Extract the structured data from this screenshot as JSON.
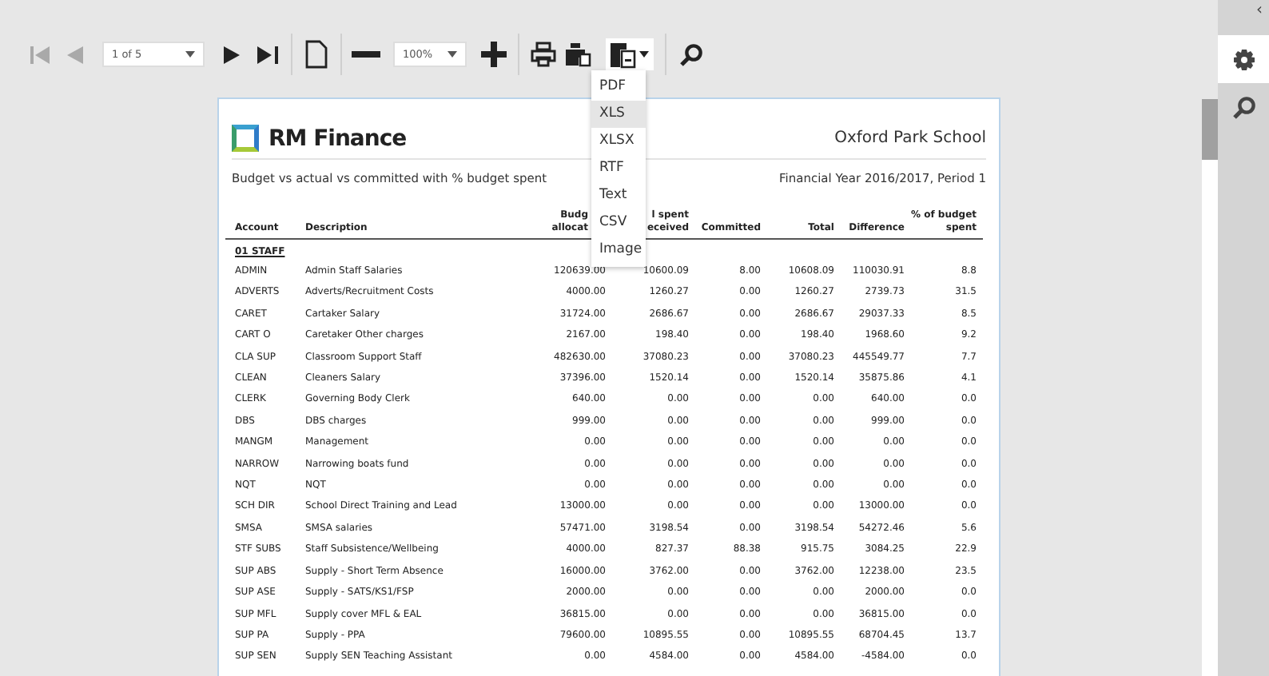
{
  "toolbar": {
    "items": [
      {
        "kind": "first",
        "disabled": true
      },
      {
        "kind": "prev",
        "disabled": true
      },
      {
        "kind": "select",
        "value": "1 of 5"
      },
      {
        "kind": "next",
        "disabled": false
      },
      {
        "kind": "last",
        "disabled": false
      },
      {
        "kind": "separator"
      },
      {
        "kind": "page",
        "disabled": false
      },
      {
        "kind": "separator"
      },
      {
        "kind": "minus",
        "disabled": false
      },
      {
        "kind": "select",
        "value": "100%"
      },
      {
        "kind": "plus",
        "disabled": false
      },
      {
        "kind": "separator"
      },
      {
        "kind": "print",
        "disabled": false
      },
      {
        "kind": "printlayout",
        "disabled": false
      },
      {
        "kind": "export",
        "expanded": true
      },
      {
        "kind": "separator"
      },
      {
        "kind": "search",
        "disabled": false
      }
    ]
  },
  "export_menu": [
    {
      "label": "PDF",
      "selected": false
    },
    {
      "label": "XLS",
      "selected": true
    },
    {
      "label": "XLSX",
      "selected": false
    },
    {
      "label": "RTF",
      "selected": false
    },
    {
      "label": "Text",
      "selected": false
    },
    {
      "label": "CSV",
      "selected": false
    },
    {
      "label": "Image",
      "selected": false
    }
  ],
  "report": {
    "brand": "RM Finance",
    "school": "Oxford Park School",
    "subtitle": "Budget vs actual vs committed with % budget spent",
    "period": "Financial Year 2016/2017, Period 1",
    "columns": [
      {
        "lines": [
          "Account"
        ]
      },
      {
        "lines": [
          "Description"
        ]
      },
      {
        "lines": [
          "Budg",
          "allocat"
        ]
      },
      {
        "lines": [
          "l spent",
          "eceived"
        ]
      },
      {
        "lines": [
          "Committed"
        ]
      },
      {
        "lines": [
          "Total"
        ]
      },
      {
        "lines": [
          "Difference"
        ]
      },
      {
        "lines": [
          "% of budget",
          "spent"
        ]
      }
    ],
    "section": "01 STAFF",
    "rows": [
      [
        "ADMIN",
        "Admin Staff Salaries",
        "120639.00",
        "10600.09",
        "8.00",
        "10608.09",
        "110030.91",
        "8.8"
      ],
      [
        "ADVERTS",
        "Adverts/Recruitment Costs",
        "4000.00",
        "1260.27",
        "0.00",
        "1260.27",
        "2739.73",
        "31.5"
      ],
      [
        "CARET",
        "Cartaker Salary",
        "31724.00",
        "2686.67",
        "0.00",
        "2686.67",
        "29037.33",
        "8.5"
      ],
      [
        "CART O",
        "Caretaker Other charges",
        "2167.00",
        "198.40",
        "0.00",
        "198.40",
        "1968.60",
        "9.2"
      ],
      [
        "CLA SUP",
        "Classroom Support Staff",
        "482630.00",
        "37080.23",
        "0.00",
        "37080.23",
        "445549.77",
        "7.7"
      ],
      [
        "CLEAN",
        "Cleaners Salary",
        "37396.00",
        "1520.14",
        "0.00",
        "1520.14",
        "35875.86",
        "4.1"
      ],
      [
        "CLERK",
        "Governing Body Clerk",
        "640.00",
        "0.00",
        "0.00",
        "0.00",
        "640.00",
        "0.0"
      ],
      [
        "DBS",
        "DBS charges",
        "999.00",
        "0.00",
        "0.00",
        "0.00",
        "999.00",
        "0.0"
      ],
      [
        "MANGM",
        "Management",
        "0.00",
        "0.00",
        "0.00",
        "0.00",
        "0.00",
        "0.0"
      ],
      [
        "NARROW",
        "Narrowing boats fund",
        "0.00",
        "0.00",
        "0.00",
        "0.00",
        "0.00",
        "0.0"
      ],
      [
        "NQT",
        "NQT",
        "0.00",
        "0.00",
        "0.00",
        "0.00",
        "0.00",
        "0.0"
      ],
      [
        "SCH DIR",
        "School Direct Training and Lead",
        "13000.00",
        "0.00",
        "0.00",
        "0.00",
        "13000.00",
        "0.0"
      ],
      [
        "SMSA",
        "SMSA salaries",
        "57471.00",
        "3198.54",
        "0.00",
        "3198.54",
        "54272.46",
        "5.6"
      ],
      [
        "STF SUBS",
        "Staff Subsistence/Wellbeing",
        "4000.00",
        "827.37",
        "88.38",
        "915.75",
        "3084.25",
        "22.9"
      ],
      [
        "SUP ABS",
        "Supply - Short Term Absence",
        "16000.00",
        "3762.00",
        "0.00",
        "3762.00",
        "12238.00",
        "23.5"
      ],
      [
        "SUP ASE",
        "Supply - SATS/KS1/FSP",
        "2000.00",
        "0.00",
        "0.00",
        "0.00",
        "2000.00",
        "0.0"
      ],
      [
        "SUP MFL",
        "Supply cover MFL & EAL",
        "36815.00",
        "0.00",
        "0.00",
        "0.00",
        "36815.00",
        "0.0"
      ],
      [
        "SUP PA",
        "Supply - PPA",
        "79600.00",
        "10895.55",
        "0.00",
        "10895.55",
        "68704.45",
        "13.7"
      ],
      [
        "SUP SEN",
        "Supply SEN Teaching Assistant",
        "0.00",
        "4584.00",
        "0.00",
        "4584.00",
        "-4584.00",
        "0.0"
      ]
    ]
  },
  "side_panel": {
    "collapse": "‹",
    "tabs": [
      {
        "kind": "settings",
        "selected": true
      },
      {
        "kind": "search",
        "selected": false
      }
    ]
  }
}
